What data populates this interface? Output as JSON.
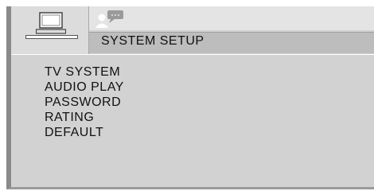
{
  "tabs": [
    {
      "icon": "monitor-icon",
      "selected": true
    },
    {
      "icon": "person-speech-icon",
      "selected": false
    }
  ],
  "header": {
    "title": "SYSTEM SETUP"
  },
  "menu": {
    "items": [
      {
        "label": "TV SYSTEM"
      },
      {
        "label": "AUDIO PLAY"
      },
      {
        "label": "PASSWORD"
      },
      {
        "label": "RATING"
      },
      {
        "label": "DEFAULT"
      }
    ]
  },
  "colors": {
    "panel": "#d2d2d2",
    "header": "#bdbdbd",
    "text": "#111111"
  }
}
